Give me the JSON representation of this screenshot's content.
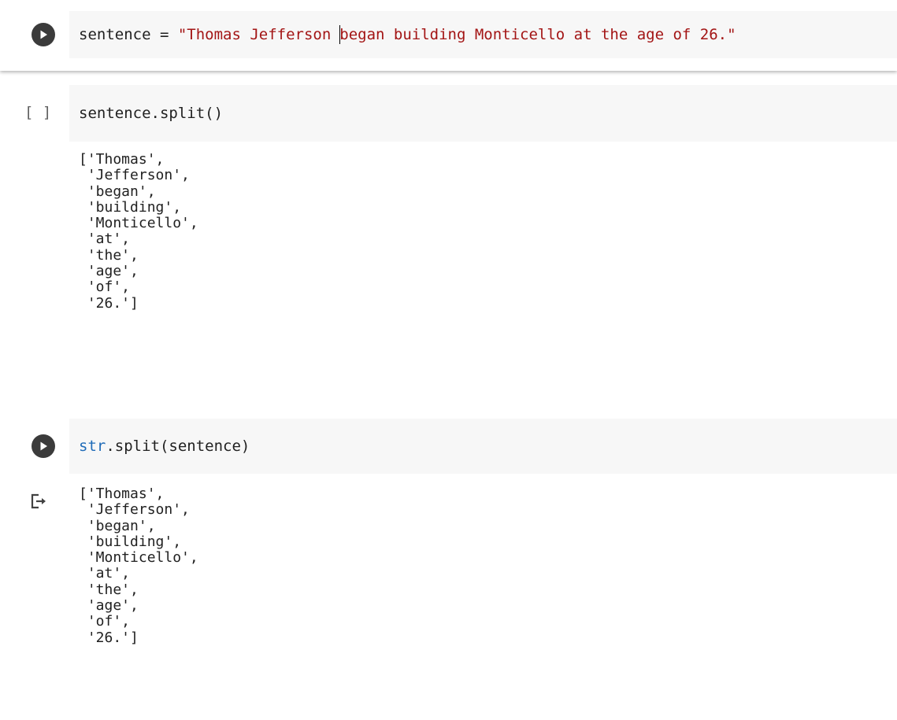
{
  "cells": [
    {
      "type": "code",
      "state": "active",
      "code_parts": [
        {
          "kind": "plain",
          "text": "sentence = "
        },
        {
          "kind": "string",
          "text": "\"Thomas Jefferson "
        },
        {
          "kind": "string",
          "text": "began building Monticello at the age of 26.\""
        }
      ]
    },
    {
      "type": "code",
      "state": "not-run",
      "indicator": "[ ]",
      "code": "sentence.split()",
      "output_lines": [
        "['Thomas',",
        " 'Jefferson',",
        " 'began',",
        " 'building',",
        " 'Monticello',",
        " 'at',",
        " 'the',",
        " 'age',",
        " 'of',",
        " '26.']"
      ]
    },
    {
      "type": "code",
      "state": "run",
      "code_parts": [
        {
          "kind": "builtin",
          "text": "str"
        },
        {
          "kind": "plain",
          "text": ".split(sentence)"
        }
      ],
      "output_icon": "output-arrow-icon",
      "output_lines": [
        "['Thomas',",
        " 'Jefferson',",
        " 'began',",
        " 'building',",
        " 'Monticello',",
        " 'at',",
        " 'the',",
        " 'age',",
        " 'of',",
        " '26.']"
      ]
    }
  ],
  "colors": {
    "string": "#a31515",
    "builtin": "#1e6bb8",
    "code_bg": "#f7f7f7",
    "run_button": "#3b3b3b"
  },
  "icons": [
    "play-icon",
    "output-arrow-icon"
  ]
}
